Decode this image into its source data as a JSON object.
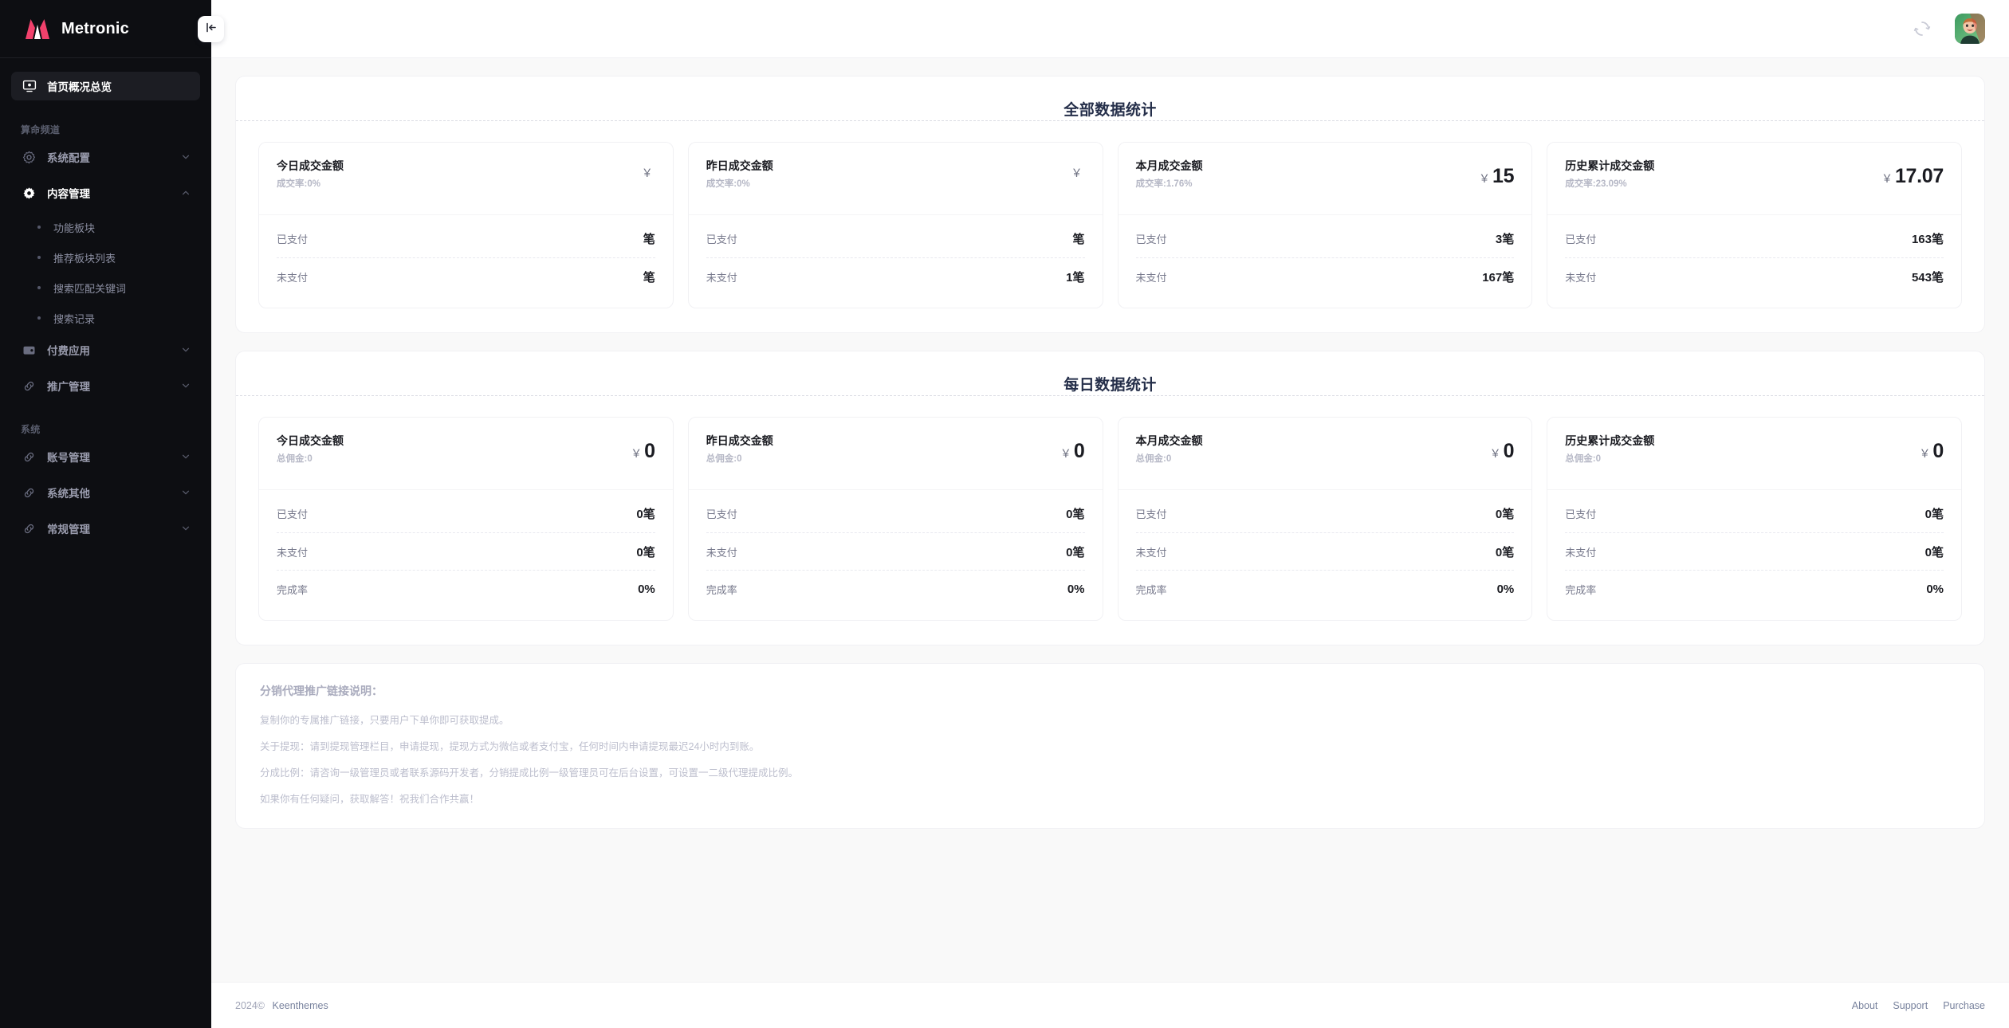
{
  "brand": {
    "name": "Metronic",
    "logo_icon": "metronic-logo-icon"
  },
  "sidebar": {
    "collapse_icon": "collapse-left-icon",
    "home": {
      "label": "首页概况总览",
      "icon": "monitor-icon"
    },
    "sections": [
      {
        "label": "算命频道",
        "items": [
          {
            "label": "系统配置",
            "icon": "gear-icon",
            "arrow": "chevron-down-icon",
            "expanded": false,
            "children": []
          },
          {
            "label": "内容管理",
            "icon": "gear-icon",
            "arrow": "chevron-up-icon",
            "expanded": true,
            "children": [
              {
                "label": "功能板块"
              },
              {
                "label": "推荐板块列表"
              },
              {
                "label": "搜索匹配关键词"
              },
              {
                "label": "搜索记录"
              }
            ]
          },
          {
            "label": "付费应用",
            "icon": "wallet-icon",
            "arrow": "chevron-down-icon",
            "expanded": false,
            "children": []
          },
          {
            "label": "推广管理",
            "icon": "link-icon",
            "arrow": "chevron-down-icon",
            "expanded": false,
            "children": []
          }
        ]
      },
      {
        "label": "系统",
        "items": [
          {
            "label": "账号管理",
            "icon": "link-icon",
            "arrow": "chevron-down-icon",
            "expanded": false,
            "children": []
          },
          {
            "label": "系统其他",
            "icon": "link-icon",
            "arrow": "chevron-down-icon",
            "expanded": false,
            "children": []
          },
          {
            "label": "常规管理",
            "icon": "link-icon",
            "arrow": "chevron-down-icon",
            "expanded": false,
            "children": []
          }
        ]
      }
    ]
  },
  "topbar": {
    "spinner_icon": "refresh-spinner-icon",
    "avatar_icon": "user-avatar"
  },
  "panels": [
    {
      "title": "全部数据统计",
      "cards": [
        {
          "title": "今日成交金额",
          "sub": "成交率:0%",
          "currency": "￥",
          "value": "",
          "rows": [
            {
              "label": "已支付",
              "value": "笔"
            },
            {
              "label": "未支付",
              "value": "笔"
            }
          ]
        },
        {
          "title": "昨日成交金额",
          "sub": "成交率:0%",
          "currency": "￥",
          "value": "",
          "rows": [
            {
              "label": "已支付",
              "value": "笔"
            },
            {
              "label": "未支付",
              "value": "1笔"
            }
          ]
        },
        {
          "title": "本月成交金额",
          "sub": "成交率:1.76%",
          "currency": "￥",
          "value": "15",
          "rows": [
            {
              "label": "已支付",
              "value": "3笔"
            },
            {
              "label": "未支付",
              "value": "167笔"
            }
          ]
        },
        {
          "title": "历史累计成交金额",
          "sub": "成交率:23.09%",
          "currency": "￥",
          "value": "17.07",
          "rows": [
            {
              "label": "已支付",
              "value": "163笔"
            },
            {
              "label": "未支付",
              "value": "543笔"
            }
          ]
        }
      ]
    },
    {
      "title": "每日数据统计",
      "cards": [
        {
          "title": "今日成交金额",
          "sub": "总佣金:0",
          "currency": "￥",
          "value": "0",
          "rows": [
            {
              "label": "已支付",
              "value": "0笔"
            },
            {
              "label": "未支付",
              "value": "0笔"
            },
            {
              "label": "完成率",
              "value": "0%"
            }
          ]
        },
        {
          "title": "昨日成交金额",
          "sub": "总佣金:0",
          "currency": "￥",
          "value": "0",
          "rows": [
            {
              "label": "已支付",
              "value": "0笔"
            },
            {
              "label": "未支付",
              "value": "0笔"
            },
            {
              "label": "完成率",
              "value": "0%"
            }
          ]
        },
        {
          "title": "本月成交金额",
          "sub": "总佣金:0",
          "currency": "￥",
          "value": "0",
          "rows": [
            {
              "label": "已支付",
              "value": "0笔"
            },
            {
              "label": "未支付",
              "value": "0笔"
            },
            {
              "label": "完成率",
              "value": "0%"
            }
          ]
        },
        {
          "title": "历史累计成交金额",
          "sub": "总佣金:0",
          "currency": "￥",
          "value": "0",
          "rows": [
            {
              "label": "已支付",
              "value": "0笔"
            },
            {
              "label": "未支付",
              "value": "0笔"
            },
            {
              "label": "完成率",
              "value": "0%"
            }
          ]
        }
      ]
    }
  ],
  "notes": {
    "title": "分销代理推广链接说明：",
    "lines": [
      "复制你的专属推广链接，只要用户下单你即可获取提成。",
      "关于提现：请到提现管理栏目，申请提现，提现方式为微信或者支付宝，任何时间内申请提现最迟24小时内到账。",
      "分成比例：请咨询一级管理员或者联系源码开发者，分销提成比例一级管理员可在后台设置，可设置一二级代理提成比例。",
      "如果你有任何疑问，获取解答！祝我们合作共赢！"
    ]
  },
  "footer": {
    "year": "2024©",
    "company": "Keenthemes",
    "links": [
      "About",
      "Support",
      "Purchase"
    ]
  },
  "colors": {
    "sidebar_bg": "#0d0e12",
    "page_bg": "#f9f9f9",
    "card_bg": "#ffffff",
    "heading": "#252f4a",
    "brand_red": "#f1416c",
    "muted": "#b6b8c6"
  }
}
